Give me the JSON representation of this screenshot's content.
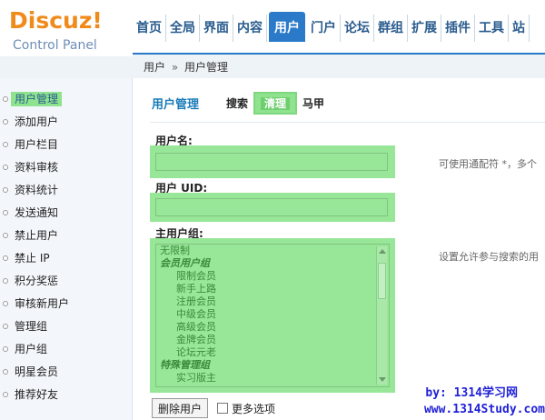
{
  "logo": {
    "main": "Discuz!",
    "sub": "Control Panel"
  },
  "topnav": {
    "items": [
      "首页",
      "全局",
      "界面",
      "内容",
      "用户",
      "门户",
      "论坛",
      "群组",
      "扩展",
      "插件",
      "工具",
      "站"
    ],
    "active_index": 4
  },
  "breadcrumb": {
    "root": "用户",
    "sep": "»",
    "current": "用户管理"
  },
  "sidebar": {
    "items": [
      "用户管理",
      "添加用户",
      "用户栏目",
      "资料审核",
      "资料统计",
      "发送通知",
      "禁止用户",
      "禁止 IP",
      "积分奖惩",
      "审核新用户",
      "管理组",
      "用户组",
      "明星会员",
      "推荐好友"
    ],
    "active_index": 0
  },
  "main": {
    "title": "用户管理",
    "tabs": [
      "搜索",
      "清理",
      "马甲"
    ],
    "username_label": "用户名:",
    "username_hint": "可使用通配符 *，多个",
    "uid_label": "用户 UID:",
    "group_label": "主用户组:",
    "group_hint": "设置允许参与搜索的用",
    "group_options": [
      {
        "text": "无限制",
        "kind": "plain"
      },
      {
        "text": "会员用户组",
        "kind": "group"
      },
      {
        "text": "限制会员",
        "kind": "indent"
      },
      {
        "text": "新手上路",
        "kind": "indent"
      },
      {
        "text": "注册会员",
        "kind": "indent"
      },
      {
        "text": "中级会员",
        "kind": "indent"
      },
      {
        "text": "高级会员",
        "kind": "indent"
      },
      {
        "text": "金牌会员",
        "kind": "indent"
      },
      {
        "text": "论坛元老",
        "kind": "indent"
      },
      {
        "text": "特殊管理组",
        "kind": "group"
      },
      {
        "text": "实习版主",
        "kind": "indent"
      }
    ],
    "delete_button": "删除用户",
    "more_options": "更多选项"
  },
  "watermark": {
    "line1": "by: 1314学习网",
    "line2": "www.1314Study.com"
  },
  "colors": {
    "accent": "#2a7ac9",
    "highlight": "#98e698",
    "logo": "#f08a1a",
    "watermark": "#2020d8"
  }
}
